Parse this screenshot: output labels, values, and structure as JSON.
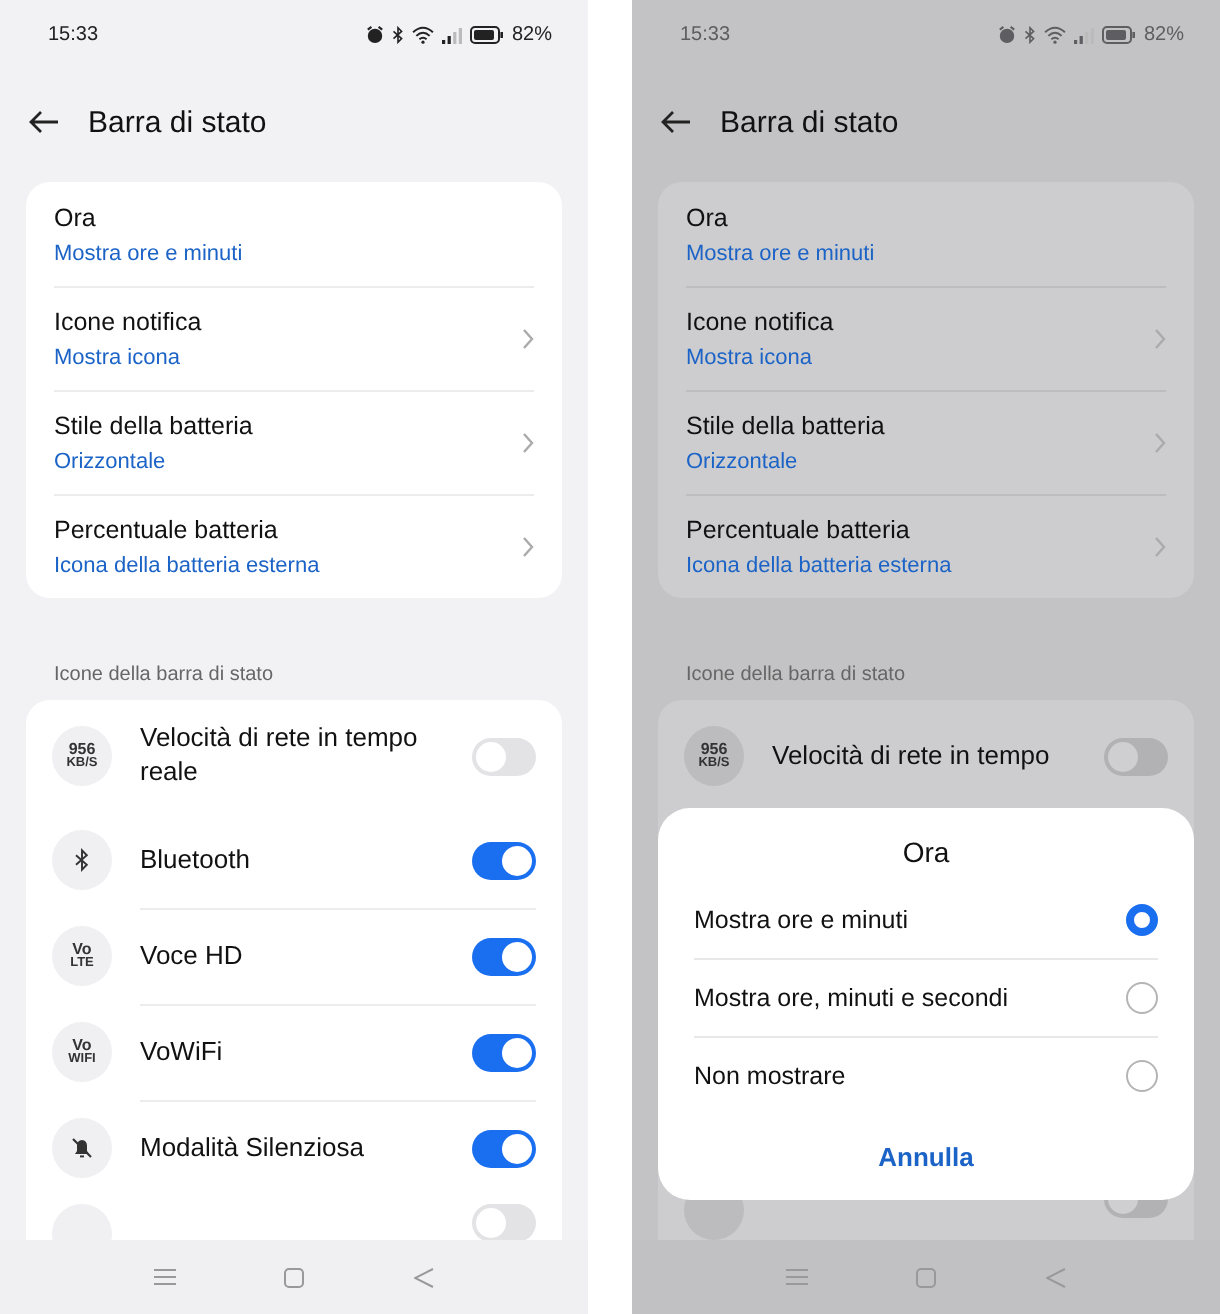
{
  "screens": [
    {
      "dimmed": false,
      "status_bar": {
        "time": "15:33",
        "battery": "82%"
      },
      "title": "Barra di stato",
      "settings": [
        {
          "kind": "plain",
          "label": "Ora",
          "value": "Mostra ore e minuti"
        },
        {
          "kind": "link",
          "label": "Icone notifica",
          "value": "Mostra icona"
        },
        {
          "kind": "link",
          "label": "Stile della batteria",
          "value": "Orizzontale"
        },
        {
          "kind": "link",
          "label": "Percentuale batteria",
          "value": "Icona della batteria esterna"
        }
      ],
      "section_label": "Icone della barra di stato",
      "toggles": [
        {
          "kind": "text",
          "icon_text": [
            "956",
            "KB/S"
          ],
          "label": "Velocità di rete in tempo reale",
          "on": false
        },
        {
          "kind": "bluetooth",
          "label": "Bluetooth",
          "on": true
        },
        {
          "kind": "text",
          "icon_text": [
            "Vo",
            "LTE"
          ],
          "label": "Voce HD",
          "on": true
        },
        {
          "kind": "text",
          "icon_text": [
            "Vo",
            "WIFI"
          ],
          "label": "VoWiFi",
          "on": true
        },
        {
          "kind": "silent",
          "label": "Modalità Silenziosa",
          "on": true
        },
        {
          "kind": "partial",
          "on": false
        }
      ]
    },
    {
      "dimmed": true,
      "status_bar": {
        "time": "15:33",
        "battery": "82%"
      },
      "title": "Barra di stato",
      "settings": [
        {
          "kind": "plain",
          "label": "Ora",
          "value": "Mostra ore e minuti"
        },
        {
          "kind": "link",
          "label": "Icone notifica",
          "value": "Mostra icona"
        },
        {
          "kind": "link",
          "label": "Stile della batteria",
          "value": "Orizzontale"
        },
        {
          "kind": "link",
          "label": "Percentuale batteria",
          "value": "Icona della batteria esterna"
        }
      ],
      "section_label": "Icone della barra di stato",
      "toggles": [
        {
          "kind": "text",
          "icon_text": [
            "956",
            "KB/S"
          ],
          "label": "Velocità di rete in tempo",
          "on": false
        },
        {
          "kind": "partial",
          "on": false
        }
      ],
      "dialog": {
        "title": "Ora",
        "options": [
          {
            "label": "Mostra ore e minuti",
            "selected": true
          },
          {
            "label": "Mostra ore, minuti e secondi",
            "selected": false
          },
          {
            "label": "Non mostrare",
            "selected": false
          }
        ],
        "cancel": "Annulla"
      }
    }
  ]
}
